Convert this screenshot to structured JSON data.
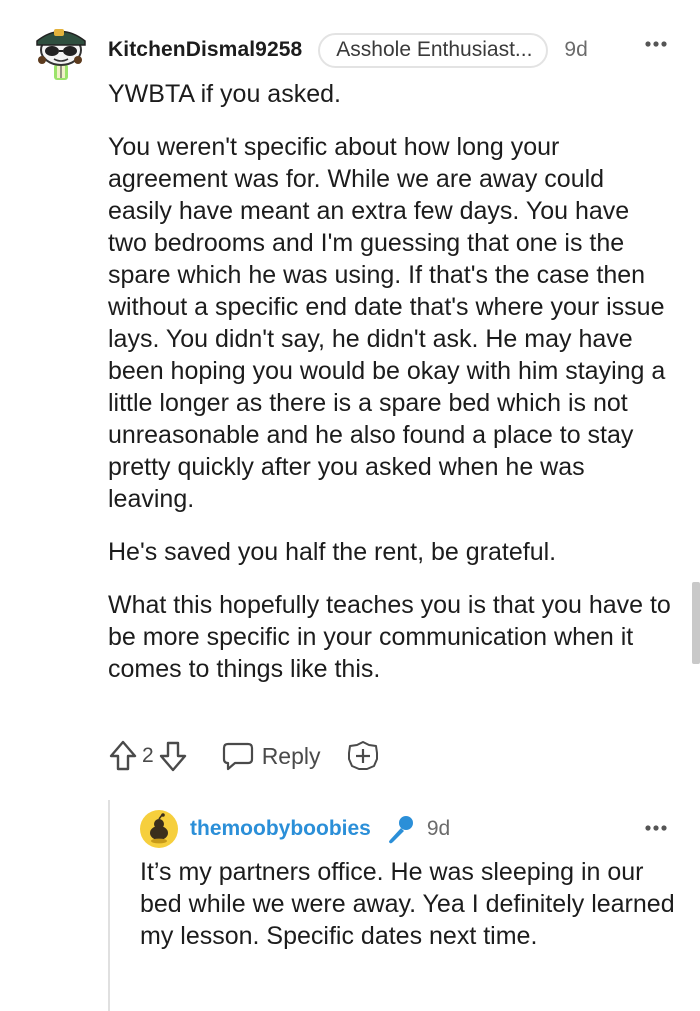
{
  "comment": {
    "username": "KitchenDismal9258",
    "flair": "Asshole Enthusiast...",
    "time": "9d",
    "paragraphs": [
      "YWBTA if you asked.",
      "You weren't specific about how long your agreement was for. While we are away could easily have meant an extra few days. You have two bedrooms and I'm guessing that one is the spare which he was using. If that's the case then without a specific end date that's where your issue lays. You didn't say, he didn't ask. He may have been hoping you would be okay with him staying a little longer as there is a spare bed which is not unreasonable and he also found a place to stay pretty quickly after you asked when he was leaving.",
      "He's saved you half the rent, be grateful.",
      "What this hopefully teaches you is that you have to be more specific in your communication when it comes to things like this."
    ],
    "vote_count": "2",
    "reply_label": "Reply"
  },
  "reply": {
    "username": "themoobyboobies",
    "time": "9d",
    "text": "It’s my partners office. He was sleeping in our bed while we were away. Yea I definitely learned my lesson. Specific dates next time."
  },
  "icons": {
    "upvote": "upvote-arrow-icon",
    "downvote": "downvote-arrow-icon",
    "reply": "speech-bubble-icon",
    "award": "award-plus-icon",
    "more": "more-dots-icon",
    "op": "microphone-icon"
  },
  "colors": {
    "reply_username": "#2b8fd8",
    "mic": "#2b8fd8",
    "text": "#1c1c1c",
    "meta": "#6b6b6b"
  }
}
